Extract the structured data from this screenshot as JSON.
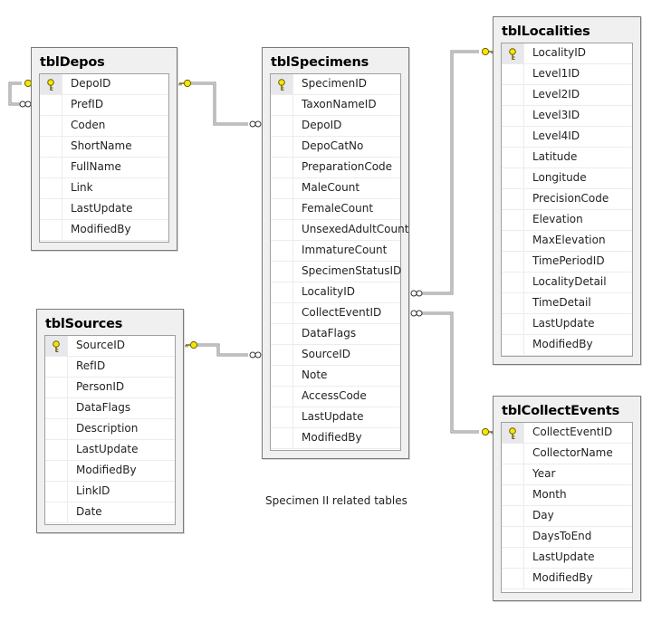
{
  "caption": "Specimen II related tables",
  "tables": {
    "depos": {
      "title": "tblDepos",
      "columns": [
        "DepoID",
        "PrefID",
        "Coden",
        "ShortName",
        "FullName",
        "Link",
        "LastUpdate",
        "ModifiedBy"
      ],
      "primary_key": "DepoID"
    },
    "specimens": {
      "title": "tblSpecimens",
      "columns": [
        "SpecimenID",
        "TaxonNameID",
        "DepoID",
        "DepoCatNo",
        "PreparationCode",
        "MaleCount",
        "FemaleCount",
        "UnsexedAdultCount",
        "ImmatureCount",
        "SpecimenStatusID",
        "LocalityID",
        "CollectEventID",
        "DataFlags",
        "SourceID",
        "Note",
        "AccessCode",
        "LastUpdate",
        "ModifiedBy"
      ],
      "primary_key": "SpecimenID"
    },
    "localities": {
      "title": "tblLocalities",
      "columns": [
        "LocalityID",
        "Level1ID",
        "Level2ID",
        "Level3ID",
        "Level4ID",
        "Latitude",
        "Longitude",
        "PrecisionCode",
        "Elevation",
        "MaxElevation",
        "TimePeriodID",
        "LocalityDetail",
        "TimeDetail",
        "LastUpdate",
        "ModifiedBy"
      ],
      "primary_key": "LocalityID"
    },
    "collect_events": {
      "title": "tblCollectEvents",
      "columns": [
        "CollectEventID",
        "CollectorName",
        "Year",
        "Month",
        "Day",
        "DaysToEnd",
        "LastUpdate",
        "ModifiedBy"
      ],
      "primary_key": "CollectEventID"
    },
    "sources": {
      "title": "tblSources",
      "columns": [
        "SourceID",
        "RefID",
        "PersonID",
        "DataFlags",
        "Description",
        "LastUpdate",
        "ModifiedBy",
        "LinkID",
        "Date"
      ],
      "primary_key": "SourceID"
    }
  },
  "relationships": [
    {
      "from": "tblDepos",
      "to": "tblDepos",
      "type": "one-to-many",
      "note": "self reference"
    },
    {
      "from": "tblDepos",
      "to": "tblSpecimens",
      "type": "one-to-many"
    },
    {
      "from": "tblSources",
      "to": "tblSpecimens",
      "type": "one-to-many"
    },
    {
      "from": "tblLocalities",
      "to": "tblSpecimens",
      "type": "one-to-many"
    },
    {
      "from": "tblCollectEvents",
      "to": "tblSpecimens",
      "type": "one-to-many"
    }
  ],
  "colors": {
    "key_fill": "#f5e800",
    "key_stroke": "#7a6a00",
    "connector": "#808080"
  }
}
